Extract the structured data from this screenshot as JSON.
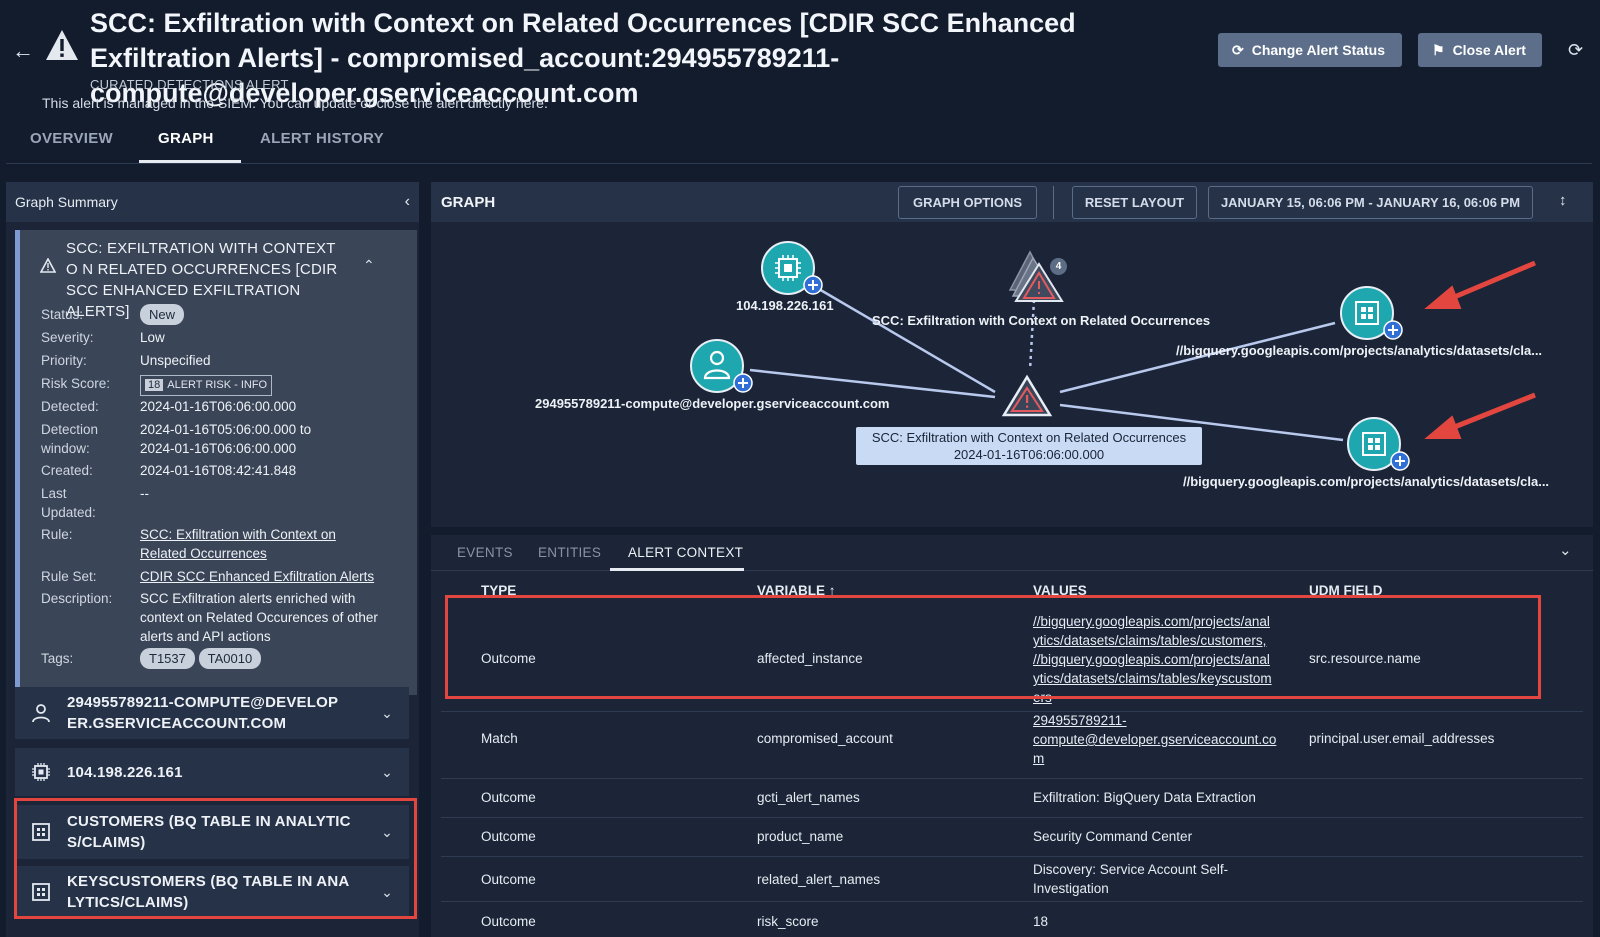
{
  "header": {
    "title": "SCC: Exfiltration with Context on Related Occurrences [CDIR SCC Enhanced Exfiltration Alerts] - compromised_account:294955789211-compute@developer.gserviceaccount.com",
    "subtitle": "CURATED DETECTIONS ALERT",
    "managed_note": "This alert is managed in the SIEM. You can update or close the alert directly here.",
    "change_status_label": "Change Alert Status",
    "close_alert_label": "Close Alert"
  },
  "tabs": [
    {
      "label": "OVERVIEW",
      "active": false
    },
    {
      "label": "GRAPH",
      "active": true
    },
    {
      "label": "ALERT HISTORY",
      "active": false
    }
  ],
  "summary_panel": {
    "title": "Graph Summary",
    "alert_title": "SCC: EXFILTRATION WITH CONTEXT O N RELATED OCCURRENCES [CDIR SCC ENHANCED EXFILTRATION ALERTS]",
    "status_label": "Status:",
    "status": "New",
    "severity_label": "Severity:",
    "severity": "Low",
    "priority_label": "Priority:",
    "priority": "Unspecified",
    "risk_label": "Risk Score:",
    "risk_score": "18",
    "risk_text": "ALERT RISK - INFO",
    "detected_label": "Detected:",
    "detected": "2024-01-16T06:06:00.000",
    "window_label_1": "Detection",
    "window_label_2": "window:",
    "window_1": "2024-01-16T05:06:00.000 to",
    "window_2": "2024-01-16T06:06:00.000",
    "created_label": "Created:",
    "created": "2024-01-16T08:42:41.848",
    "updated_label_1": "Last",
    "updated_label_2": "Updated:",
    "updated": "--",
    "rule_label": "Rule:",
    "rule": "SCC: Exfiltration with Context on Related Occurrences",
    "ruleset_label": "Rule Set:",
    "ruleset": "CDIR SCC Enhanced Exfiltration Alerts",
    "desc_label": "Description:",
    "description": "SCC Exfiltration alerts enriched with context on Related Occurences of other alerts and API actions",
    "tags_label": "Tags:",
    "tags": [
      "T1537",
      "TA0010"
    ]
  },
  "entity_cards": [
    {
      "label": "294955789211-COMPUTE@DEVELOP ER.GSERVICEACCOUNT.COM",
      "icon": "user-icon"
    },
    {
      "label": "104.198.226.161",
      "icon": "chip-icon"
    },
    {
      "label": "CUSTOMERS (BQ TABLE IN ANALYTIC S/CLAIMS)",
      "icon": "table-icon"
    },
    {
      "label": "KEYSCUSTOMERS (BQ TABLE IN ANA LYTICS/CLAIMS)",
      "icon": "table-icon"
    }
  ],
  "graph": {
    "title": "GRAPH",
    "options_label": "GRAPH OPTIONS",
    "reset_label": "RESET LAYOUT",
    "date_range": "JANUARY 15, 06:06 PM - JANUARY 16, 06:06 PM",
    "nodes": {
      "ip": "104.198.226.161",
      "account": "294955789211-compute@developer.gserviceaccount.com",
      "related": "SCC: Exfiltration with Context on Related Occurrences",
      "related_count": "4",
      "table1": "//bigquery.googleapis.com/projects/analytics/datasets/cla...",
      "table2": "//bigquery.googleapis.com/projects/analytics/datasets/cla...",
      "center_1": "SCC: Exfiltration with Context on Related Occurrences",
      "center_2": "2024-01-16T06:06:00.000"
    }
  },
  "bottom_tabs": [
    {
      "label": "EVENTS",
      "active": false
    },
    {
      "label": "ENTITIES",
      "active": false
    },
    {
      "label": "ALERT CONTEXT",
      "active": true
    }
  ],
  "table": {
    "headers": [
      "TYPE",
      "VARIABLE ↑",
      "VALUES",
      "UDM FIELD"
    ],
    "rows": [
      {
        "type": "Outcome",
        "variable": "affected_instance",
        "values": [
          "//bigquery.googleapis.com/projects/anal",
          "ytics/datasets/claims/tables/customers,",
          "//bigquery.googleapis.com/projects/anal",
          "ytics/datasets/claims/tables/keyscustom",
          "ers"
        ],
        "udm": "src.resource.name"
      },
      {
        "type": "Match",
        "variable": "compromised_account",
        "values": [
          "294955789211-",
          "compute@developer.gserviceaccount.co",
          "m"
        ],
        "udm": "principal.user.email_addresses"
      },
      {
        "type": "Outcome",
        "variable": "gcti_alert_names",
        "values": [
          "Exfiltration: BigQuery Data Extraction"
        ],
        "udm": ""
      },
      {
        "type": "Outcome",
        "variable": "product_name",
        "values": [
          "Security Command Center"
        ],
        "udm": ""
      },
      {
        "type": "Outcome",
        "variable": "related_alert_names",
        "values": [
          "Discovery: Service Account Self-",
          "Investigation"
        ],
        "udm": ""
      },
      {
        "type": "Outcome",
        "variable": "risk_score",
        "values": [
          "18"
        ],
        "udm": ""
      }
    ]
  },
  "colors": {
    "background": "#121c2d",
    "highlight_red": "#e2463f",
    "node_teal": "#1fa7b0",
    "edge": "#b9c9ee"
  }
}
